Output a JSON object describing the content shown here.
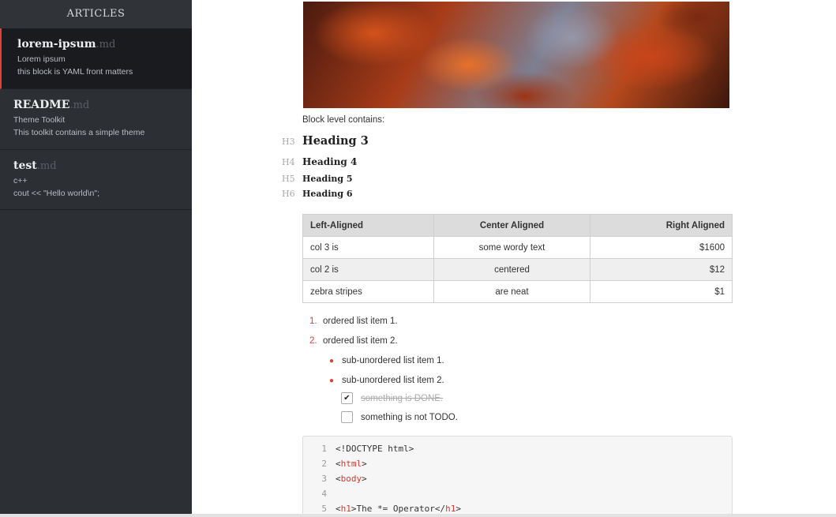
{
  "sidebar": {
    "header": "ARTICLES",
    "articles": [
      {
        "name": "lorem-ipsum",
        "ext": ".md",
        "line1": "Lorem ipsum",
        "line2": "this block is YAML front matters"
      },
      {
        "name": "README",
        "ext": ".md",
        "line1": "Theme Toolkit",
        "line2": "This toolkit contains a simple theme"
      },
      {
        "name": "test",
        "ext": ".md",
        "line1": "c++",
        "line2": "cout << \"Hello world\\n\";"
      }
    ]
  },
  "main": {
    "block_label": "Block level contains:",
    "headings": [
      {
        "mark": "H3",
        "text": "Heading 3"
      },
      {
        "mark": "H4",
        "text": "Heading 4"
      },
      {
        "mark": "H5",
        "text": "Heading 5"
      },
      {
        "mark": "H6",
        "text": "Heading 6"
      }
    ],
    "table": {
      "headers": [
        "Left-Aligned",
        "Center Aligned",
        "Right Aligned"
      ],
      "rows": [
        [
          "col 3 is",
          "some wordy text",
          "$1600"
        ],
        [
          "col 2 is",
          "centered",
          "$12"
        ],
        [
          "zebra stripes",
          "are neat",
          "$1"
        ]
      ]
    },
    "ordered_list": [
      {
        "num": "1.",
        "text": "ordered list item 1."
      },
      {
        "num": "2.",
        "text": "ordered list item 2."
      }
    ],
    "unordered_list": [
      {
        "bullet": "●",
        "text": "sub-unordered list item 1."
      },
      {
        "bullet": "●",
        "text": "sub-unordered list item 2."
      }
    ],
    "tasks": [
      {
        "checked": true,
        "mark": "✔",
        "text": "something is DONE."
      },
      {
        "checked": false,
        "mark": "",
        "text": "something is not TODO."
      }
    ],
    "code": {
      "lines": [
        {
          "n": "1",
          "pre": "<!DOCTYPE html>",
          "tag": "",
          "post": ""
        },
        {
          "n": "2",
          "pre": "<",
          "tag": "html",
          "post": ">"
        },
        {
          "n": "3",
          "pre": "<",
          "tag": "body",
          "post": ">"
        },
        {
          "n": "4",
          "pre": "",
          "tag": "",
          "post": ""
        },
        {
          "n": "5",
          "pre": "<",
          "tag": "h1",
          "post": ">The *= Operator</",
          "tag2": "h1",
          "post2": ">"
        }
      ]
    }
  },
  "colors": {
    "accent": "#e0403a",
    "sidebar_bg": "#2c2f33",
    "active_bg": "#1a1b1e"
  }
}
